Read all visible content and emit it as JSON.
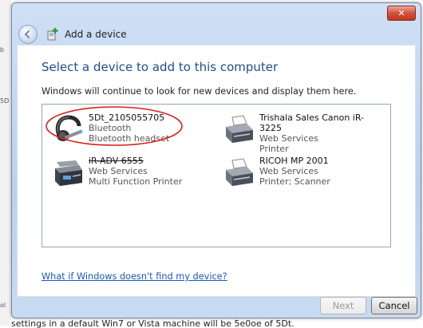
{
  "window": {
    "title": "Add a device",
    "close_label": "✕"
  },
  "header": {
    "heading": "Select a device to add to this computer",
    "subtext": "Windows will continue to look for new devices and display them here."
  },
  "devices": [
    {
      "name": "5Dt_2105055705",
      "line1": "Bluetooth",
      "line2": "Bluetooth headset",
      "icon": "bluetooth-headset-icon"
    },
    {
      "name": "Trishala Sales Canon iR-3225",
      "line1": "Web Services",
      "line2": "Printer",
      "icon": "printer-icon"
    },
    {
      "name": "iR-ADV 6555",
      "line1": "Web Services",
      "line2": "Multi Function Printer",
      "icon": "multifunction-printer-icon"
    },
    {
      "name": "RICOH MP 2001",
      "line1": "Web Services",
      "line2": "Printer; Scanner",
      "icon": "printer-icon"
    }
  ],
  "help_link": "What if Windows doesn't find my device?",
  "buttons": {
    "next": "Next",
    "cancel": "Cancel"
  },
  "background": {
    "caption": "settings in a default Win7 or Vista machine will be 5e0oe of 5Dt.",
    "left_marks": [
      "b",
      "5D",
      "ol"
    ]
  },
  "colors": {
    "heading": "#1f4e8c",
    "link": "#1a56b8",
    "annotation": "#d6221b",
    "close": "#c1381f"
  }
}
